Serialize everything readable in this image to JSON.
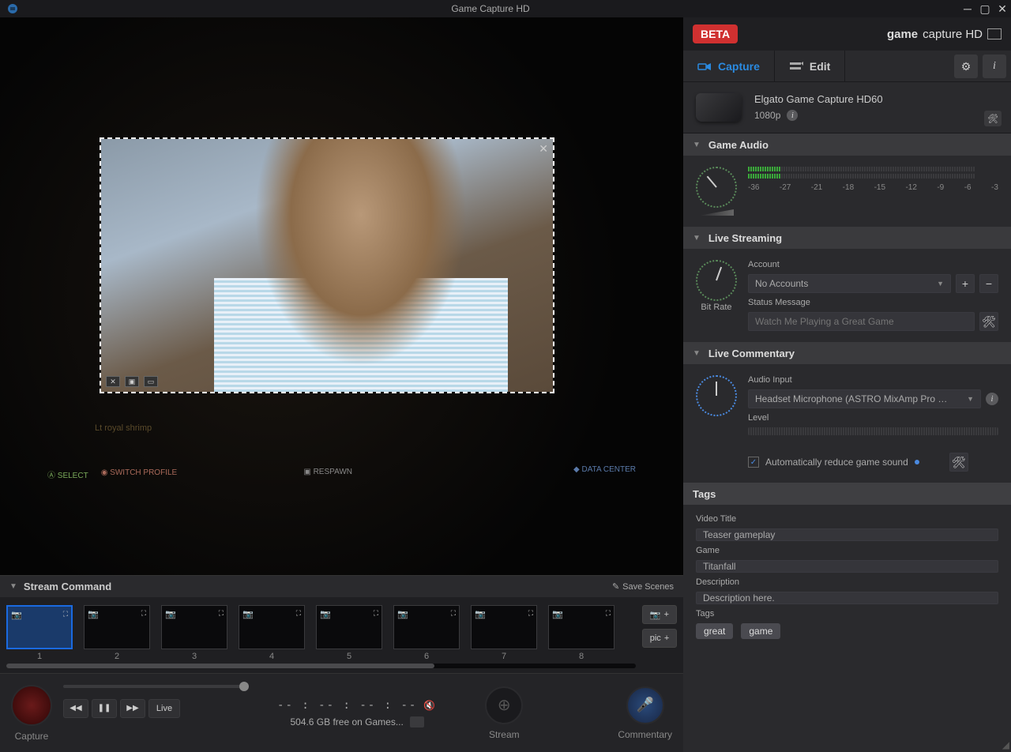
{
  "window": {
    "title": "Game Capture HD"
  },
  "branding": {
    "beta": "BETA",
    "brand_bold": "game",
    "brand_light": "capture HD"
  },
  "tabs": {
    "capture": "Capture",
    "edit": "Edit"
  },
  "device": {
    "name": "Elgato Game Capture HD60",
    "resolution": "1080p"
  },
  "sections": {
    "game_audio": "Game Audio",
    "live_streaming": "Live Streaming",
    "live_commentary": "Live Commentary",
    "tags": "Tags"
  },
  "audio_scale": [
    "-36",
    "-27",
    "-21",
    "-18",
    "-15",
    "-12",
    "-9",
    "-6",
    "-3"
  ],
  "streaming": {
    "knob_label": "Bit Rate",
    "account_label": "Account",
    "account_value": "No Accounts",
    "status_label": "Status Message",
    "status_placeholder": "Watch Me Playing a Great Game"
  },
  "commentary": {
    "input_label": "Audio Input",
    "input_value": "Headset Microphone (ASTRO MixAmp Pro …",
    "level_label": "Level",
    "auto_reduce": "Automatically reduce game sound"
  },
  "tags": {
    "video_title_label": "Video Title",
    "video_title": "Teaser gameplay",
    "game_label": "Game",
    "game": "Titanfall",
    "description_label": "Description",
    "description": "Description here.",
    "tags_label": "Tags",
    "chips": [
      "great",
      "game"
    ]
  },
  "stream_cmd": {
    "title": "Stream Command",
    "save": "Save Scenes",
    "scenes": [
      "1",
      "2",
      "3",
      "4",
      "5",
      "6",
      "7",
      "8"
    ],
    "pic_btn": "pic"
  },
  "preview": {
    "lt_text": "Lt royal shrimp",
    "select": "SELECT",
    "switch": "SWITCH PROFILE",
    "respawn": "RESPAWN",
    "datacenter": "DATA CENTER"
  },
  "bottom": {
    "capture": "Capture",
    "stream": "Stream",
    "commentary": "Commentary",
    "live": "Live",
    "time": "-- : -- : -- : --",
    "disk": "504.6 GB free on Games..."
  }
}
